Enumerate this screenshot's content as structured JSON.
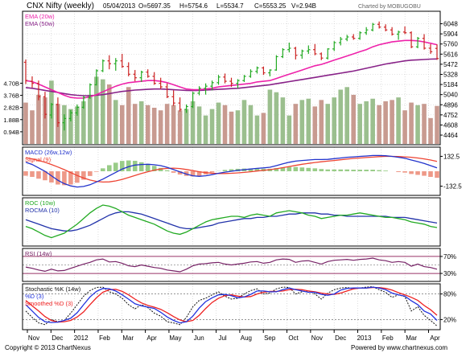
{
  "colors": {
    "up": "#22aa22",
    "down": "#cc2222",
    "ema20": "#ee22aa",
    "ema50": "#882288",
    "volUp": "#9bbf8e",
    "volDown": "#c89a90",
    "macd": "#2233cc",
    "signal": "#ee4433",
    "histUp": "#99cc88",
    "histDown": "#ee9988",
    "roc": "#22aa22",
    "rocma": "#2233aa",
    "rsi": "#772266",
    "rsiBand": "#993366",
    "stoK": "#111111",
    "stoD": "#2233dd",
    "stoSD": "#ee2222",
    "panelBorder": "#000000",
    "grid": "#c8c8c8",
    "tick": "#000000"
  },
  "header": {
    "title": "CNX Nifty (weekly)",
    "date": "05/04/2013",
    "open": "O=5697.35",
    "high": "H=5754.6",
    "low": "L=5534.7",
    "close": "C=5553.25",
    "volume": "V=2.94B",
    "credit_top": "Charted by MOBUGOBU"
  },
  "footer": {
    "copyright": "Copyright © 2013 ChartNexus",
    "powered": "Powered by www.chartnexus.com"
  },
  "chart_data": {
    "type": "candlestick",
    "x_labels": [
      "Nov",
      "Dec",
      "2012",
      "Feb",
      "Mar",
      "Apr",
      "May",
      "Jun",
      "Jul",
      "Aug",
      "Sep",
      "Oct",
      "Nov",
      "Dec",
      "2013",
      "Feb",
      "Mar",
      "Apr"
    ],
    "price": {
      "legend": [
        "EMA (20w)",
        "EMA (50w)"
      ],
      "ylim": [
        4350,
        6180
      ],
      "y_ticks": [
        "6048",
        "5904",
        "5760",
        "5616",
        "5472",
        "5328",
        "5184",
        "5040",
        "4896",
        "4752",
        "4608",
        "4464"
      ],
      "ohlc": [
        [
          5500,
          5540,
          5190,
          5240
        ],
        [
          5230,
          5300,
          5140,
          5200
        ],
        [
          5200,
          5240,
          4960,
          5010
        ],
        [
          5010,
          5080,
          4700,
          4760
        ],
        [
          4750,
          4920,
          4700,
          4900
        ],
        [
          4900,
          5000,
          4580,
          4640
        ],
        [
          4640,
          4760,
          4530,
          4700
        ],
        [
          4700,
          4820,
          4660,
          4780
        ],
        [
          4780,
          4900,
          4740,
          4860
        ],
        [
          4860,
          5020,
          4840,
          5000
        ],
        [
          5000,
          5200,
          4980,
          5180
        ],
        [
          5180,
          5400,
          5170,
          5380
        ],
        [
          5380,
          5540,
          5360,
          5520
        ],
        [
          5520,
          5600,
          5400,
          5480
        ],
        [
          5480,
          5560,
          5380,
          5520
        ],
        [
          5520,
          5620,
          5420,
          5440
        ],
        [
          5440,
          5500,
          5300,
          5330
        ],
        [
          5330,
          5390,
          5230,
          5280
        ],
        [
          5280,
          5380,
          5220,
          5360
        ],
        [
          5360,
          5400,
          5280,
          5300
        ],
        [
          5300,
          5360,
          5180,
          5200
        ],
        [
          5200,
          5280,
          5120,
          5150
        ],
        [
          5150,
          5200,
          4990,
          5010
        ],
        [
          5010,
          5100,
          4880,
          4920
        ],
        [
          4920,
          5000,
          4800,
          4830
        ],
        [
          4830,
          4900,
          4780,
          4870
        ],
        [
          4870,
          5080,
          4850,
          5060
        ],
        [
          5060,
          5160,
          5030,
          5130
        ],
        [
          5130,
          5200,
          5040,
          5160
        ],
        [
          5160,
          5240,
          5100,
          5210
        ],
        [
          5210,
          5320,
          5180,
          5290
        ],
        [
          5290,
          5340,
          5200,
          5230
        ],
        [
          5230,
          5280,
          5150,
          5200
        ],
        [
          5200,
          5260,
          5130,
          5240
        ],
        [
          5240,
          5320,
          5220,
          5300
        ],
        [
          5300,
          5400,
          5280,
          5370
        ],
        [
          5370,
          5440,
          5340,
          5420
        ],
        [
          5420,
          5440,
          5320,
          5350
        ],
        [
          5350,
          5400,
          5300,
          5390
        ],
        [
          5390,
          5600,
          5380,
          5580
        ],
        [
          5580,
          5700,
          5560,
          5680
        ],
        [
          5680,
          5780,
          5640,
          5700
        ],
        [
          5700,
          5720,
          5540,
          5600
        ],
        [
          5600,
          5680,
          5550,
          5660
        ],
        [
          5660,
          5740,
          5620,
          5680
        ],
        [
          5680,
          5760,
          5600,
          5620
        ],
        [
          5620,
          5640,
          5530,
          5560
        ],
        [
          5560,
          5700,
          5540,
          5690
        ],
        [
          5690,
          5800,
          5660,
          5780
        ],
        [
          5780,
          5860,
          5740,
          5830
        ],
        [
          5830,
          5890,
          5800,
          5860
        ],
        [
          5860,
          5900,
          5820,
          5840
        ],
        [
          5840,
          5940,
          5820,
          5920
        ],
        [
          5920,
          6000,
          5890,
          5960
        ],
        [
          5960,
          6060,
          5940,
          6040
        ],
        [
          6040,
          6080,
          5980,
          6000
        ],
        [
          6000,
          6040,
          5940,
          5960
        ],
        [
          5960,
          6000,
          5880,
          5900
        ],
        [
          5900,
          5950,
          5820,
          5930
        ],
        [
          5930,
          6010,
          5900,
          5920
        ],
        [
          5920,
          5940,
          5700,
          5720
        ],
        [
          5720,
          5860,
          5700,
          5840
        ],
        [
          5840,
          5900,
          5680,
          5700
        ],
        [
          5700,
          5760,
          5620,
          5650
        ],
        [
          5697.35,
          5754.6,
          5534.7,
          5553.25
        ]
      ],
      "ema20": [
        5240,
        5225,
        5190,
        5150,
        5110,
        5070,
        5030,
        5000,
        4990,
        4990,
        5010,
        5040,
        5080,
        5120,
        5160,
        5190,
        5210,
        5220,
        5230,
        5240,
        5240,
        5230,
        5210,
        5180,
        5150,
        5120,
        5110,
        5110,
        5120,
        5130,
        5150,
        5160,
        5170,
        5180,
        5190,
        5200,
        5220,
        5230,
        5240,
        5270,
        5300,
        5330,
        5360,
        5390,
        5420,
        5450,
        5470,
        5500,
        5530,
        5560,
        5590,
        5620,
        5650,
        5680,
        5720,
        5750,
        5770,
        5790,
        5800,
        5810,
        5810,
        5805,
        5790,
        5770,
        5750
      ],
      "ema50": [
        5140,
        5130,
        5115,
        5100,
        5085,
        5070,
        5055,
        5040,
        5030,
        5025,
        5025,
        5030,
        5040,
        5055,
        5070,
        5085,
        5095,
        5105,
        5110,
        5115,
        5120,
        5120,
        5115,
        5110,
        5105,
        5100,
        5098,
        5100,
        5105,
        5110,
        5115,
        5120,
        5125,
        5130,
        5140,
        5150,
        5160,
        5170,
        5180,
        5195,
        5210,
        5225,
        5240,
        5255,
        5270,
        5285,
        5300,
        5315,
        5330,
        5345,
        5360,
        5375,
        5395,
        5415,
        5435,
        5455,
        5475,
        5490,
        5505,
        5520,
        5530,
        5535,
        5540,
        5545,
        5548
      ],
      "volume_labels": [
        "4.70B",
        "3.76B",
        "2.82B",
        "1.88B",
        "0.94B"
      ],
      "volume_ylim": [
        0,
        5.6
      ],
      "volume": [
        3.2,
        2.6,
        3.8,
        3.6,
        4.9,
        3.1,
        3.0,
        2.7,
        2.9,
        3.3,
        3.8,
        5.2,
        5.0,
        4.6,
        3.4,
        3.0,
        4.4,
        3.1,
        3.3,
        3.0,
        2.8,
        2.6,
        3.1,
        3.0,
        2.6,
        2.7,
        3.3,
        2.9,
        2.2,
        2.7,
        3.2,
        3.0,
        2.5,
        2.6,
        3.4,
        3.0,
        2.2,
        2.4,
        4.2,
        4.0,
        3.6,
        2.2,
        3.1,
        3.4,
        3.5,
        2.9,
        3.4,
        3.1,
        3.6,
        4.2,
        4.4,
        3.8,
        3.1,
        3.3,
        3.5,
        3.0,
        3.3,
        3.4,
        3.6,
        2.6,
        3.2,
        3.0,
        3.1,
        2.0,
        2.94
      ]
    },
    "macd": {
      "legend": [
        "MACD (26w,12w)",
        "Signal (9)"
      ],
      "y_ticks": [
        "132.5",
        "-132.5"
      ],
      "ylim": [
        -200,
        200
      ],
      "macd": [
        80,
        60,
        30,
        0,
        -40,
        -80,
        -110,
        -130,
        -140,
        -135,
        -120,
        -95,
        -70,
        -40,
        -10,
        20,
        40,
        55,
        60,
        62,
        58,
        50,
        35,
        15,
        -5,
        -25,
        -40,
        -45,
        -40,
        -30,
        -18,
        -8,
        0,
        8,
        14,
        20,
        26,
        30,
        36,
        50,
        66,
        80,
        90,
        96,
        100,
        104,
        104,
        106,
        112,
        118,
        124,
        128,
        132,
        136,
        140,
        140,
        138,
        132,
        124,
        116,
        100,
        86,
        70,
        50,
        30
      ],
      "signal": [
        120,
        110,
        96,
        80,
        60,
        38,
        14,
        -12,
        -38,
        -60,
        -78,
        -90,
        -96,
        -94,
        -86,
        -72,
        -56,
        -38,
        -20,
        -4,
        10,
        20,
        26,
        28,
        24,
        16,
        6,
        -4,
        -12,
        -18,
        -20,
        -20,
        -18,
        -14,
        -10,
        -4,
        2,
        8,
        14,
        22,
        32,
        42,
        52,
        62,
        70,
        78,
        84,
        90,
        96,
        102,
        108,
        114,
        118,
        122,
        126,
        130,
        132,
        132,
        131,
        128,
        124,
        118,
        110,
        100,
        88
      ]
    },
    "roc": {
      "legend": [
        "ROC (10w)",
        "ROCMA (10)"
      ],
      "ylim": [
        -20,
        20
      ],
      "roc": [
        -4,
        -6,
        -9,
        -12,
        -14,
        -12,
        -10,
        -6,
        -2,
        3,
        8,
        12,
        15,
        14,
        12,
        9,
        6,
        4,
        2,
        0,
        -2,
        -5,
        -8,
        -10,
        -11,
        -9,
        -6,
        -3,
        0,
        2,
        3,
        4,
        5,
        5,
        4,
        6,
        7,
        6,
        5,
        8,
        9,
        10,
        9,
        8,
        6,
        5,
        3,
        4,
        5,
        6,
        6,
        7,
        8,
        7,
        6,
        5,
        4,
        4,
        3,
        2,
        0,
        -1,
        -2,
        -4,
        -5
      ],
      "rocma": [
        2,
        0,
        -2,
        -4,
        -6,
        -7,
        -8,
        -8,
        -7,
        -5,
        -3,
        0,
        3,
        6,
        8,
        9,
        9,
        8,
        7,
        5,
        3,
        1,
        -1,
        -3,
        -5,
        -6,
        -6,
        -5,
        -4,
        -3,
        -1,
        0,
        1,
        2,
        3,
        3,
        4,
        4,
        5,
        5,
        6,
        7,
        7,
        8,
        8,
        8,
        7,
        7,
        6,
        6,
        5,
        5,
        5,
        5,
        5,
        5,
        5,
        4,
        4,
        4,
        3,
        2,
        1,
        0,
        -1
      ]
    },
    "rsi": {
      "legend": [
        "RSI (14w)"
      ],
      "levels": [
        "70%",
        "30%"
      ],
      "ylim": [
        15,
        85
      ],
      "rsi": [
        45,
        42,
        38,
        35,
        40,
        36,
        37,
        42,
        47,
        52,
        56,
        62,
        64,
        57,
        58,
        54,
        48,
        46,
        50,
        47,
        44,
        42,
        38,
        36,
        34,
        40,
        48,
        52,
        53,
        55,
        56,
        52,
        50,
        52,
        54,
        57,
        58,
        54,
        56,
        62,
        64,
        63,
        56,
        59,
        60,
        56,
        52,
        58,
        61,
        62,
        63,
        61,
        63,
        64,
        66,
        62,
        60,
        56,
        58,
        56,
        47,
        52,
        46,
        44,
        40
      ]
    },
    "stochastic": {
      "legend": [
        "Stochastic %K (14w)",
        "%D (3)",
        "Smoothed %D (3)"
      ],
      "levels": [
        "80%",
        "20%"
      ],
      "ylim": [
        0,
        100
      ],
      "k": [
        40,
        25,
        12,
        8,
        20,
        15,
        18,
        35,
        55,
        75,
        88,
        95,
        96,
        85,
        80,
        70,
        55,
        45,
        55,
        48,
        35,
        28,
        15,
        12,
        8,
        25,
        50,
        65,
        70,
        78,
        85,
        75,
        68,
        70,
        80,
        88,
        92,
        80,
        82,
        92,
        96,
        95,
        80,
        85,
        88,
        80,
        68,
        82,
        90,
        94,
        95,
        92,
        94,
        96,
        97,
        90,
        84,
        72,
        78,
        74,
        40,
        50,
        30,
        18,
        5
      ],
      "d": [
        55,
        40,
        25,
        15,
        13,
        14,
        18,
        23,
        36,
        55,
        73,
        86,
        93,
        92,
        87,
        78,
        68,
        57,
        52,
        49,
        46,
        37,
        26,
        18,
        12,
        15,
        28,
        47,
        62,
        71,
        78,
        79,
        76,
        71,
        73,
        79,
        87,
        87,
        85,
        85,
        90,
        94,
        90,
        87,
        84,
        84,
        79,
        77,
        80,
        89,
        93,
        94,
        94,
        94,
        96,
        94,
        90,
        82,
        78,
        75,
        64,
        55,
        40,
        33,
        18
      ],
      "sd": [
        65,
        52,
        40,
        27,
        18,
        14,
        15,
        18,
        26,
        38,
        55,
        71,
        84,
        90,
        91,
        86,
        78,
        68,
        59,
        53,
        49,
        44,
        36,
        27,
        19,
        15,
        18,
        30,
        46,
        60,
        70,
        76,
        78,
        75,
        73,
        74,
        80,
        84,
        86,
        86,
        87,
        90,
        91,
        90,
        87,
        85,
        82,
        80,
        79,
        82,
        87,
        92,
        94,
        94,
        95,
        95,
        93,
        89,
        83,
        78,
        72,
        65,
        53,
        43,
        30
      ]
    }
  }
}
